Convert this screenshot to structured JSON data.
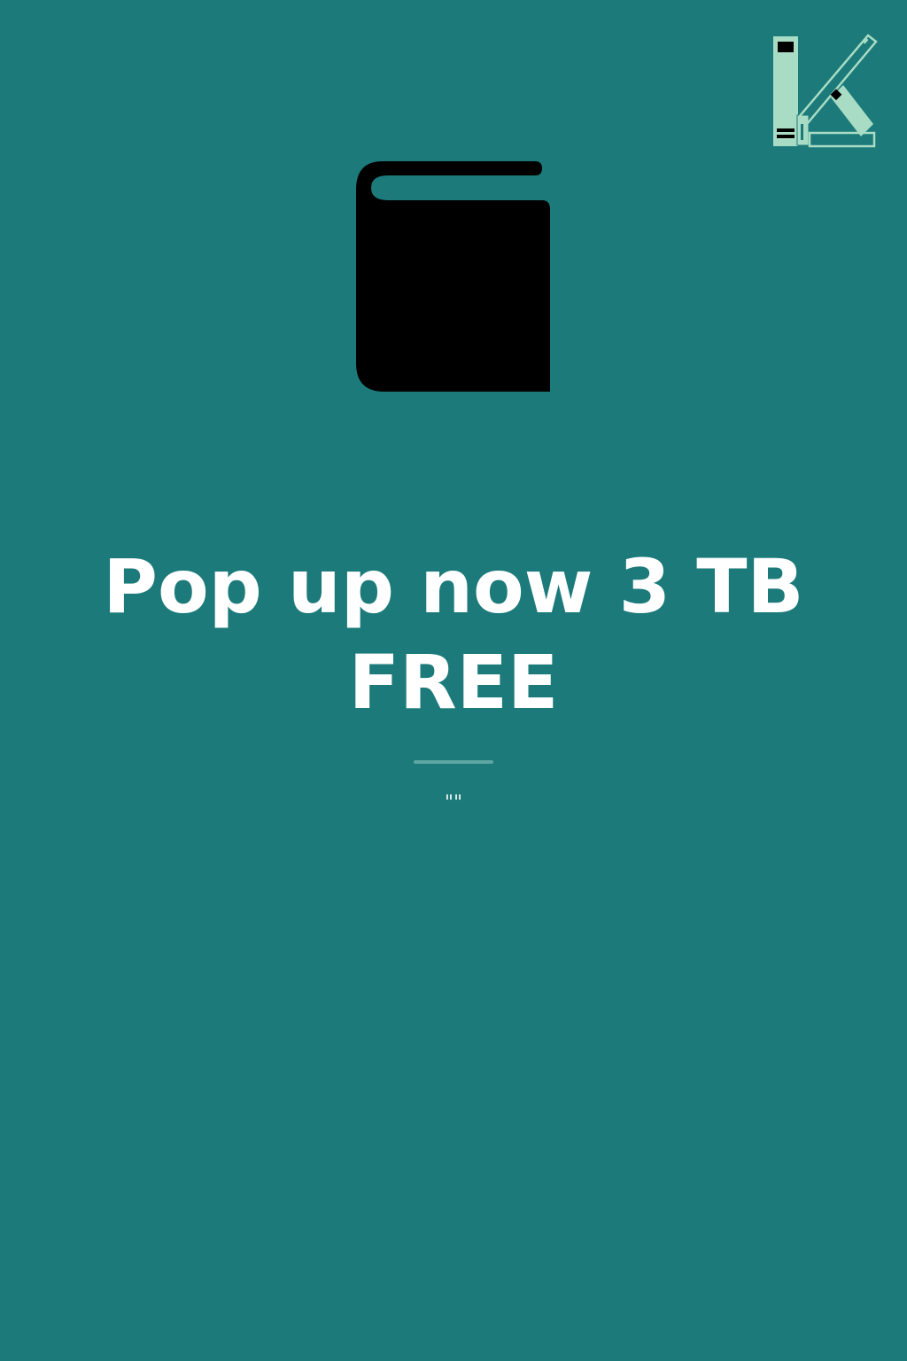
{
  "cover": {
    "title": "Pop up now 3 TB FREE",
    "subtitle": "\"\""
  },
  "icons": {
    "logo": "library-k-logo-icon",
    "book": "book-icon"
  },
  "colors": {
    "background": "#1c7a7a",
    "title_text": "#ffffff",
    "logo_fill": "#a8dcc4",
    "divider": "#5fa6a3",
    "book_fill": "#000000"
  }
}
